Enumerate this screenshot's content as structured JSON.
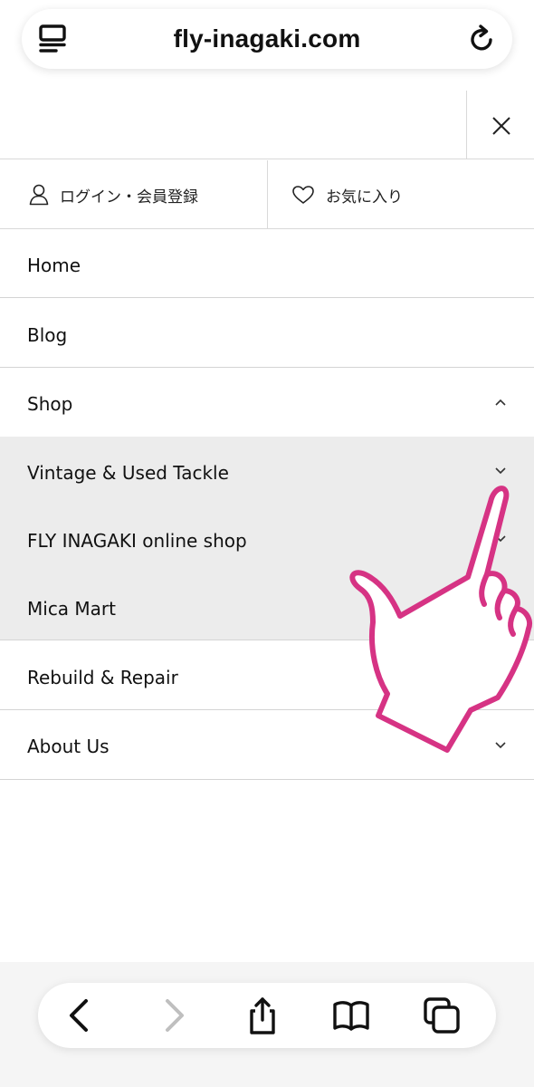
{
  "browser": {
    "url": "fly-inagaki.com",
    "icons": {
      "menu": "tab-menu-icon",
      "reload": "reload-icon"
    }
  },
  "drawer": {
    "close_icon": "close-icon",
    "account": {
      "login_label": "ログイン・会員登録",
      "favorites_label": "お気に入り"
    },
    "menu": [
      {
        "label": "Home"
      },
      {
        "label": "Blog"
      },
      {
        "label": "Shop",
        "expanded": true,
        "submenu": [
          {
            "label": "Vintage & Used Tackle"
          },
          {
            "label": "FLY INAGAKI online shop"
          },
          {
            "label": "Mica Mart"
          }
        ]
      },
      {
        "label": "Rebuild & Repair"
      },
      {
        "label": "About Us"
      }
    ]
  },
  "toolbar": {
    "icons": [
      "back-icon",
      "forward-icon",
      "share-icon",
      "bookmarks-icon",
      "tabs-icon"
    ]
  },
  "colors": {
    "hand_outline": "#d63384",
    "submenu_bg": "#ececec",
    "divider": "#d4d4d4"
  }
}
